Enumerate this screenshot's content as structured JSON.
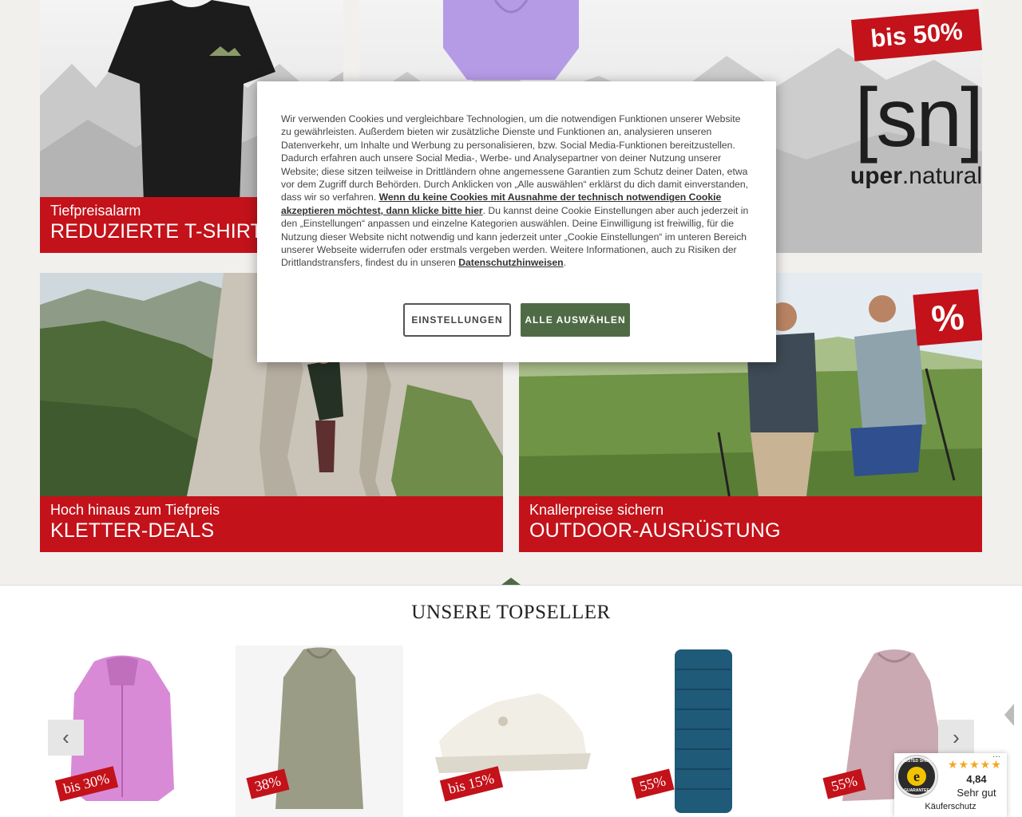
{
  "promos": {
    "tshirts": {
      "kicker": "Tiefpreisalarm",
      "title": "REDUZIERTE T-SHIRTS"
    },
    "supernatural": {
      "badge": "bis 50%",
      "logo_mark": "[sn]",
      "logo_text_bold": "uper",
      "logo_text_light": ".natural"
    },
    "climbing": {
      "kicker": "Hoch hinaus zum Tiefpreis",
      "title": "KLETTER-DEALS"
    },
    "outdoor": {
      "kicker": "Knallerpreise sichern",
      "title": "OUTDOOR-AUSRÜSTUNG",
      "badge": "%"
    }
  },
  "cookie": {
    "text_part1": "Wir verwenden Cookies und vergleichbare Technologien, um die notwendigen Funktionen unserer Website zu gewährleisten. Außerdem bieten wir zusätzliche Dienste und Funktionen an, analysieren unseren Datenverkehr, um Inhalte und Werbung zu personalisieren, bzw. Social Media-Funktionen bereitzustellen. Dadurch erfahren auch unsere Social Media-, Werbe- und Analysepartner von deiner Nutzung unserer Website; diese sitzen teilweise in Drittländern ohne angemessene Garantien zum Schutz deiner Daten, etwa vor dem Zugriff durch Behörden. Durch Anklicken von „Alle auswählen“ erklärst du dich damit einverstanden, dass wir so verfahren. ",
    "link_reject": "Wenn du keine Cookies mit Ausnahme der technisch notwendigen Cookie akzeptieren möchtest, dann klicke bitte hier",
    "text_part2": ". Du kannst deine Cookie Einstellungen aber auch jederzeit in den „Einstellungen“ anpassen und einzelne Kategorien auswählen. Deine Einwilligung ist freiwillig, für die Nutzung dieser Website nicht notwendig und kann jederzeit unter „Cookie Einstellungen“ im unteren Bereich unserer Webseite widerrufen oder erstmals vergeben werden. Weitere Informationen, auch zu Risiken der Drittlandstransfers, findest du in unseren ",
    "link_privacy": "Datenschutzhinweisen",
    "text_part3": ".",
    "settings_label": "EINSTELLUNGEN",
    "accept_label": "ALLE AUSWÄHLEN"
  },
  "topseller": {
    "title": "UNSERE TOPSELLER",
    "products": [
      {
        "badge": "bis 30%",
        "image": "pink rain jacket"
      },
      {
        "badge": "38%",
        "image": "olive parka"
      },
      {
        "badge": "bis 15%",
        "image": "white running shoe"
      },
      {
        "badge": "55%",
        "image": "blue sleeping pad"
      },
      {
        "badge": "55%",
        "image": "rose parka"
      }
    ],
    "prev_icon": "chevron-left-icon",
    "next_icon": "chevron-right-icon"
  },
  "trusted_shops": {
    "seal_line1": "TRUSTED SHOPS",
    "seal_line2": "GUARANTEE",
    "rating": "4,84",
    "rating_label": "Sehr gut",
    "stars": 5,
    "footer": "Käuferschutz",
    "more": "..."
  }
}
